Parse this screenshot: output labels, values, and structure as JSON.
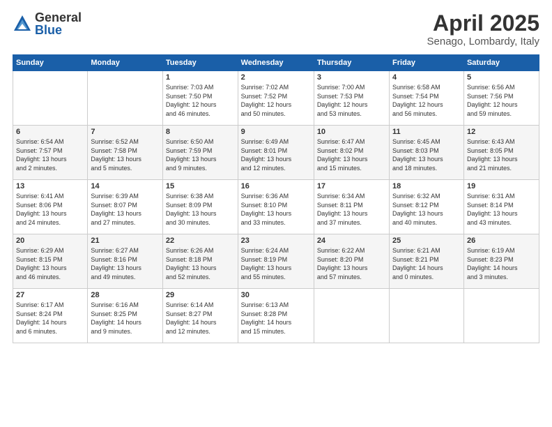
{
  "logo": {
    "general": "General",
    "blue": "Blue"
  },
  "title": "April 2025",
  "location": "Senago, Lombardy, Italy",
  "days_header": [
    "Sunday",
    "Monday",
    "Tuesday",
    "Wednesday",
    "Thursday",
    "Friday",
    "Saturday"
  ],
  "weeks": [
    [
      {
        "day": "",
        "info": ""
      },
      {
        "day": "",
        "info": ""
      },
      {
        "day": "1",
        "info": "Sunrise: 7:03 AM\nSunset: 7:50 PM\nDaylight: 12 hours\nand 46 minutes."
      },
      {
        "day": "2",
        "info": "Sunrise: 7:02 AM\nSunset: 7:52 PM\nDaylight: 12 hours\nand 50 minutes."
      },
      {
        "day": "3",
        "info": "Sunrise: 7:00 AM\nSunset: 7:53 PM\nDaylight: 12 hours\nand 53 minutes."
      },
      {
        "day": "4",
        "info": "Sunrise: 6:58 AM\nSunset: 7:54 PM\nDaylight: 12 hours\nand 56 minutes."
      },
      {
        "day": "5",
        "info": "Sunrise: 6:56 AM\nSunset: 7:56 PM\nDaylight: 12 hours\nand 59 minutes."
      }
    ],
    [
      {
        "day": "6",
        "info": "Sunrise: 6:54 AM\nSunset: 7:57 PM\nDaylight: 13 hours\nand 2 minutes."
      },
      {
        "day": "7",
        "info": "Sunrise: 6:52 AM\nSunset: 7:58 PM\nDaylight: 13 hours\nand 5 minutes."
      },
      {
        "day": "8",
        "info": "Sunrise: 6:50 AM\nSunset: 7:59 PM\nDaylight: 13 hours\nand 9 minutes."
      },
      {
        "day": "9",
        "info": "Sunrise: 6:49 AM\nSunset: 8:01 PM\nDaylight: 13 hours\nand 12 minutes."
      },
      {
        "day": "10",
        "info": "Sunrise: 6:47 AM\nSunset: 8:02 PM\nDaylight: 13 hours\nand 15 minutes."
      },
      {
        "day": "11",
        "info": "Sunrise: 6:45 AM\nSunset: 8:03 PM\nDaylight: 13 hours\nand 18 minutes."
      },
      {
        "day": "12",
        "info": "Sunrise: 6:43 AM\nSunset: 8:05 PM\nDaylight: 13 hours\nand 21 minutes."
      }
    ],
    [
      {
        "day": "13",
        "info": "Sunrise: 6:41 AM\nSunset: 8:06 PM\nDaylight: 13 hours\nand 24 minutes."
      },
      {
        "day": "14",
        "info": "Sunrise: 6:39 AM\nSunset: 8:07 PM\nDaylight: 13 hours\nand 27 minutes."
      },
      {
        "day": "15",
        "info": "Sunrise: 6:38 AM\nSunset: 8:09 PM\nDaylight: 13 hours\nand 30 minutes."
      },
      {
        "day": "16",
        "info": "Sunrise: 6:36 AM\nSunset: 8:10 PM\nDaylight: 13 hours\nand 33 minutes."
      },
      {
        "day": "17",
        "info": "Sunrise: 6:34 AM\nSunset: 8:11 PM\nDaylight: 13 hours\nand 37 minutes."
      },
      {
        "day": "18",
        "info": "Sunrise: 6:32 AM\nSunset: 8:12 PM\nDaylight: 13 hours\nand 40 minutes."
      },
      {
        "day": "19",
        "info": "Sunrise: 6:31 AM\nSunset: 8:14 PM\nDaylight: 13 hours\nand 43 minutes."
      }
    ],
    [
      {
        "day": "20",
        "info": "Sunrise: 6:29 AM\nSunset: 8:15 PM\nDaylight: 13 hours\nand 46 minutes."
      },
      {
        "day": "21",
        "info": "Sunrise: 6:27 AM\nSunset: 8:16 PM\nDaylight: 13 hours\nand 49 minutes."
      },
      {
        "day": "22",
        "info": "Sunrise: 6:26 AM\nSunset: 8:18 PM\nDaylight: 13 hours\nand 52 minutes."
      },
      {
        "day": "23",
        "info": "Sunrise: 6:24 AM\nSunset: 8:19 PM\nDaylight: 13 hours\nand 55 minutes."
      },
      {
        "day": "24",
        "info": "Sunrise: 6:22 AM\nSunset: 8:20 PM\nDaylight: 13 hours\nand 57 minutes."
      },
      {
        "day": "25",
        "info": "Sunrise: 6:21 AM\nSunset: 8:21 PM\nDaylight: 14 hours\nand 0 minutes."
      },
      {
        "day": "26",
        "info": "Sunrise: 6:19 AM\nSunset: 8:23 PM\nDaylight: 14 hours\nand 3 minutes."
      }
    ],
    [
      {
        "day": "27",
        "info": "Sunrise: 6:17 AM\nSunset: 8:24 PM\nDaylight: 14 hours\nand 6 minutes."
      },
      {
        "day": "28",
        "info": "Sunrise: 6:16 AM\nSunset: 8:25 PM\nDaylight: 14 hours\nand 9 minutes."
      },
      {
        "day": "29",
        "info": "Sunrise: 6:14 AM\nSunset: 8:27 PM\nDaylight: 14 hours\nand 12 minutes."
      },
      {
        "day": "30",
        "info": "Sunrise: 6:13 AM\nSunset: 8:28 PM\nDaylight: 14 hours\nand 15 minutes."
      },
      {
        "day": "",
        "info": ""
      },
      {
        "day": "",
        "info": ""
      },
      {
        "day": "",
        "info": ""
      }
    ]
  ]
}
